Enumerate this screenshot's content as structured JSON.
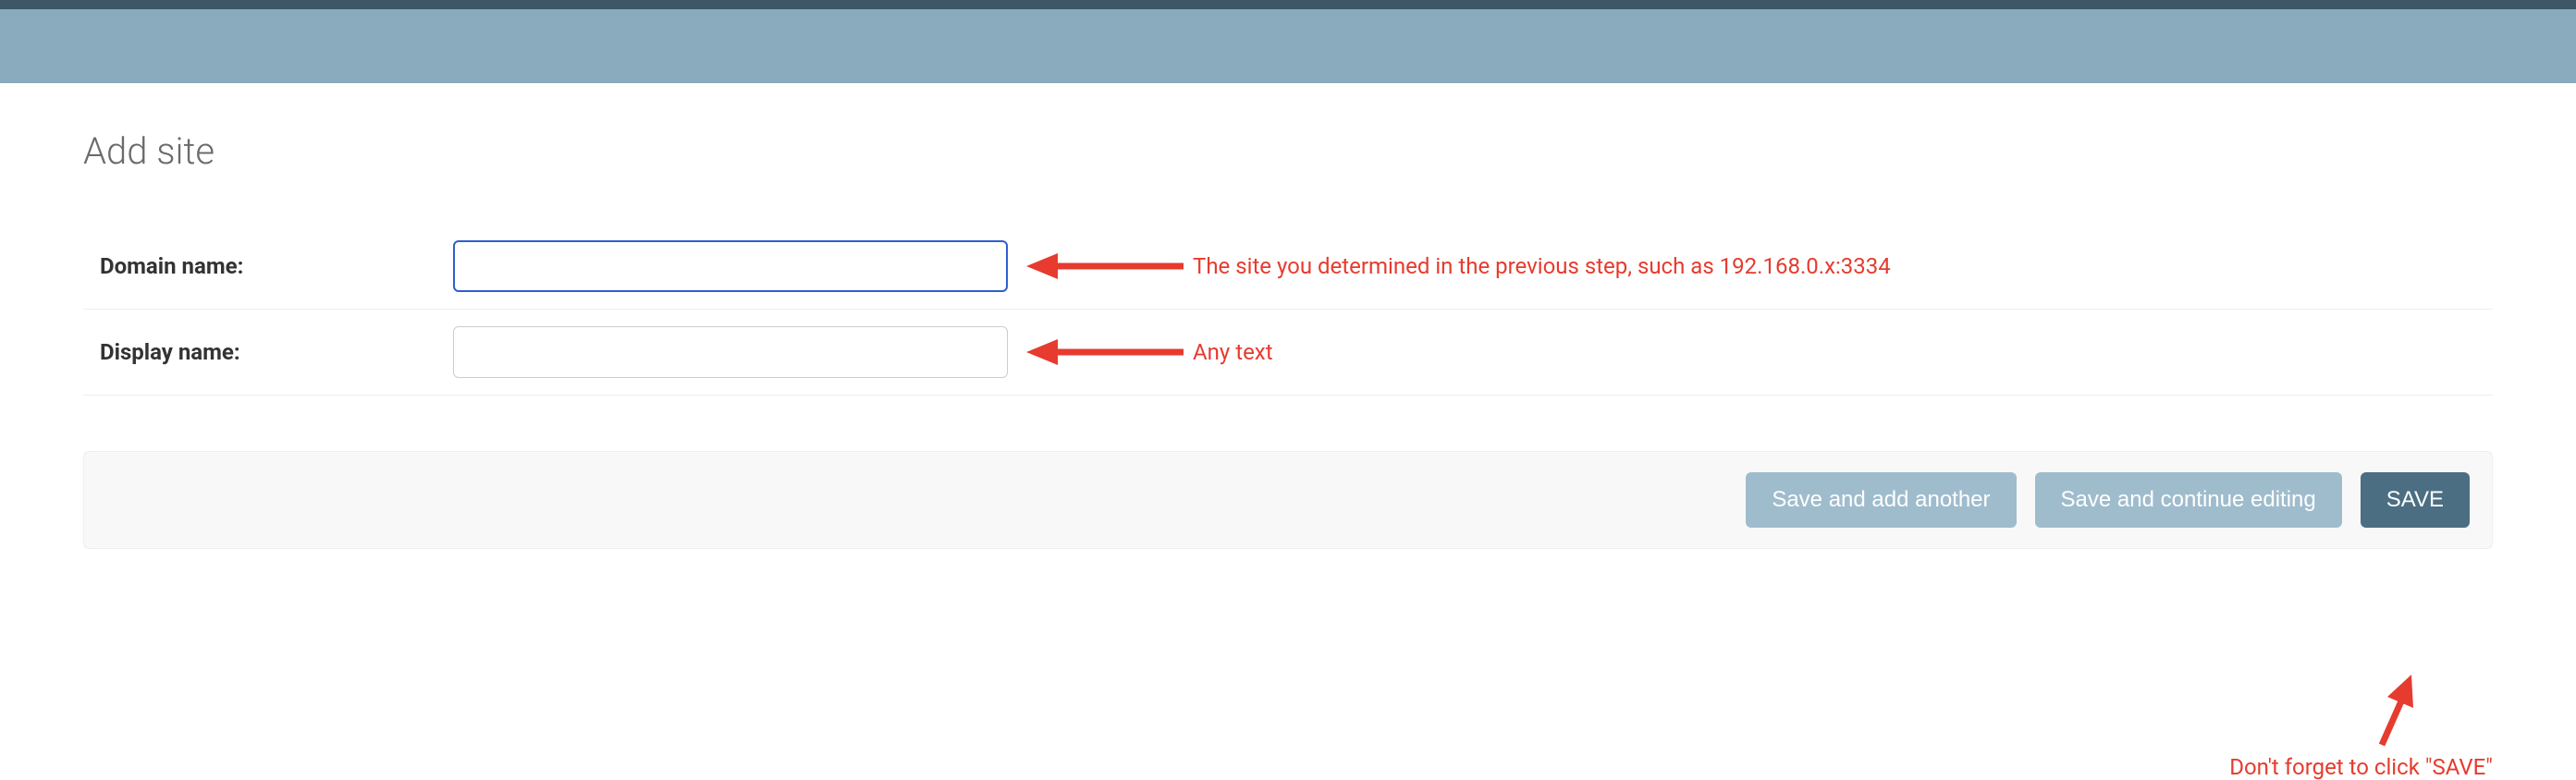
{
  "header": {
    "title": "Add site"
  },
  "fields": {
    "domain": {
      "label": "Domain name:",
      "value": "",
      "annotation": "The site you determined in the previous step, such as 192.168.0.x:3334"
    },
    "display": {
      "label": "Display name:",
      "value": "",
      "annotation": "Any text"
    }
  },
  "buttons": {
    "save_add_another": "Save and add another",
    "save_continue": "Save and continue editing",
    "save": "SAVE"
  },
  "annotations": {
    "save_reminder": "Don't forget to click \"SAVE\""
  },
  "colors": {
    "annotation": "#e63b2e",
    "header_bar": "#8aaabd",
    "btn_light": "#9fbccd",
    "btn_primary": "#4b6e82"
  }
}
